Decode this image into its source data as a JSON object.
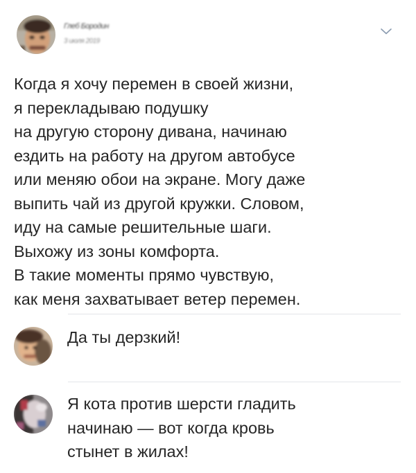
{
  "post": {
    "author_name": "Глеб Бородин",
    "author_sub": "3 июля 2019",
    "menu_icon": "chevron-down-icon",
    "text_lines": [
      "Когда я хочу перемен в своей жизни,",
      "я перекладываю подушку",
      "на другую сторону дивана, начинаю",
      "ездить на работу на другом автобусе",
      "или меняю обои на экране. Могу даже",
      "выпить чай из другой кружки. Словом,",
      "иду на самые решительные шаги.",
      "Выхожу из зоны комфорта.",
      "В такие моменты прямо чувствую,",
      "как меня захватывает ветер перемен."
    ]
  },
  "comments": [
    {
      "text_lines": [
        "Да ты дерзкий!"
      ]
    },
    {
      "text_lines": [
        "Я кота против шерсти гладить",
        "начинаю — вот когда кровь",
        "стынет в жилах!"
      ]
    }
  ],
  "colors": {
    "text": "#262626",
    "divider": "#e3e5e8",
    "chevron": "#8a9bb0"
  }
}
